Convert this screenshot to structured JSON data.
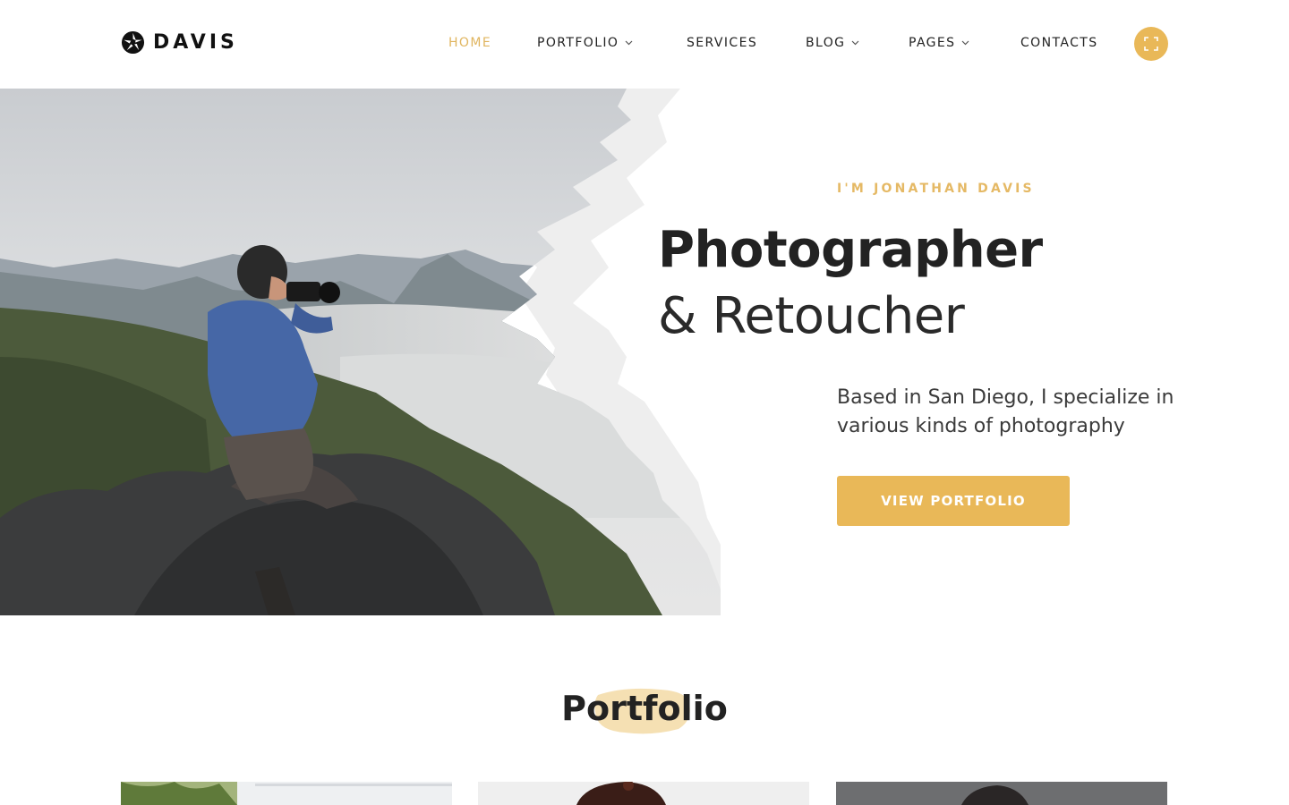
{
  "brand": {
    "name": "DAVIS",
    "logo_icon": "camera-aperture-icon"
  },
  "nav": {
    "items": [
      {
        "label": "HOME",
        "active": true,
        "has_dropdown": false
      },
      {
        "label": "PORTFOLIO",
        "active": false,
        "has_dropdown": true
      },
      {
        "label": "SERVICES",
        "active": false,
        "has_dropdown": false
      },
      {
        "label": "BLOG",
        "active": false,
        "has_dropdown": true
      },
      {
        "label": "PAGES",
        "active": false,
        "has_dropdown": true
      },
      {
        "label": "CONTACTS",
        "active": false,
        "has_dropdown": false
      }
    ],
    "fullscreen_icon": "fullscreen-icon"
  },
  "hero": {
    "eyebrow": "I'M JONATHAN DAVIS",
    "title_bold": "Photographer",
    "title_light": "& Retoucher",
    "description": "Based in San Diego, I specialize in various kinds of photography",
    "cta_label": "VIEW PORTFOLIO",
    "image": "photographer-on-mountain-rock-photo"
  },
  "portfolio": {
    "heading": "Portfolio",
    "thumbnails": [
      "portfolio-thumbnail-plant",
      "portfolio-thumbnail-portrait",
      "portfolio-thumbnail-portrait-dark"
    ]
  },
  "colors": {
    "accent": "#e9b858",
    "text": "#222222",
    "background": "#ffffff"
  }
}
